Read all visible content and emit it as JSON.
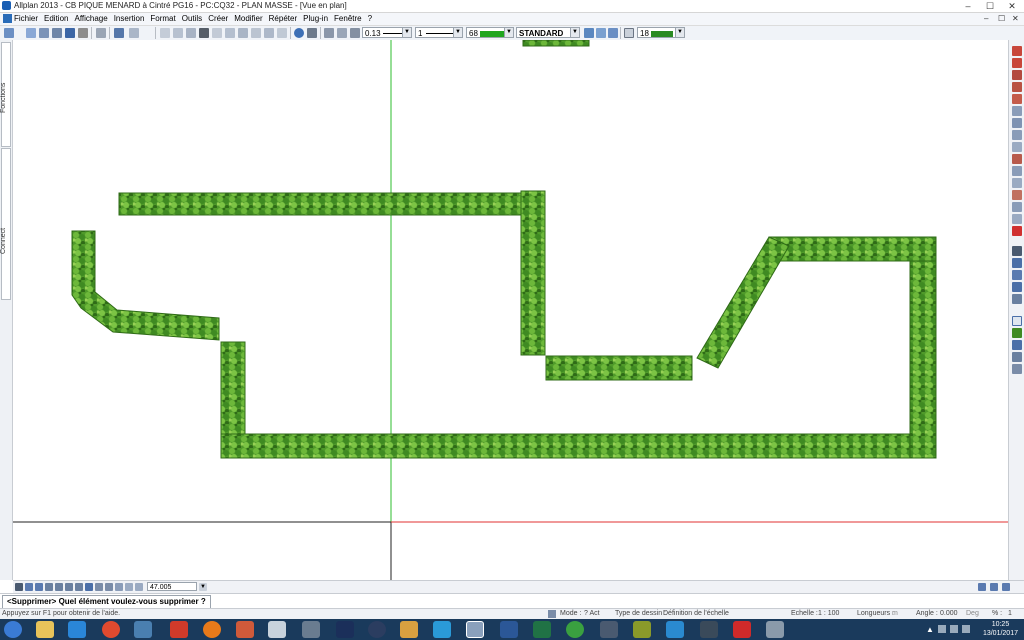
{
  "window": {
    "title": "Allplan 2013 - CB PIQUE MENARD à Cintré PG16 - PC:CQ32 - PLAN MASSE - [Vue en plan]",
    "minimize": "–",
    "maximize": "☐",
    "close": "✕"
  },
  "menu": {
    "items": [
      "Fichier",
      "Edition",
      "Affichage",
      "Insertion",
      "Format",
      "Outils",
      "Créer",
      "Modifier",
      "Répéter",
      "Plug-in",
      "Fenêtre",
      "?"
    ]
  },
  "toolbar": {
    "pen_thickness": "0.13",
    "line_type": "1",
    "color_value": "68",
    "color_swatch": "#1fa51f",
    "layer": "STANDARD",
    "pattern_value": "18"
  },
  "side_tabs": {
    "functions": "Fonctions",
    "connect": "Connect"
  },
  "zoom": {
    "value": "47.005"
  },
  "prompt": {
    "text": "<Supprimer> Quel élément voulez-vous supprimer ?"
  },
  "status": {
    "help": "Appuyez sur F1 pour obtenir de l'aide.",
    "mode_label": "Mode :",
    "mode_value": "? Act",
    "drawing_type_label": "Type de dessin :",
    "drawing_type_value": "Définition de l'échelle",
    "scale_label": "Echelle :",
    "scale_value": "1 : 100",
    "length_label": "Longueurs :",
    "length_value": "m",
    "angle_label": "Angle :",
    "angle_value": "0.000",
    "deg_label": "Deg",
    "percent_label": "% :",
    "percent_value": "1"
  },
  "taskbar": {
    "time": "10:25",
    "date": "13/01/2017"
  },
  "colors": {
    "hedge": "#4f9a2a",
    "hedge_dark": "#2f6b17",
    "hedge_light": "#8fcf4a",
    "axis_green": "#2ebd2e",
    "axis_red": "#e03030"
  }
}
